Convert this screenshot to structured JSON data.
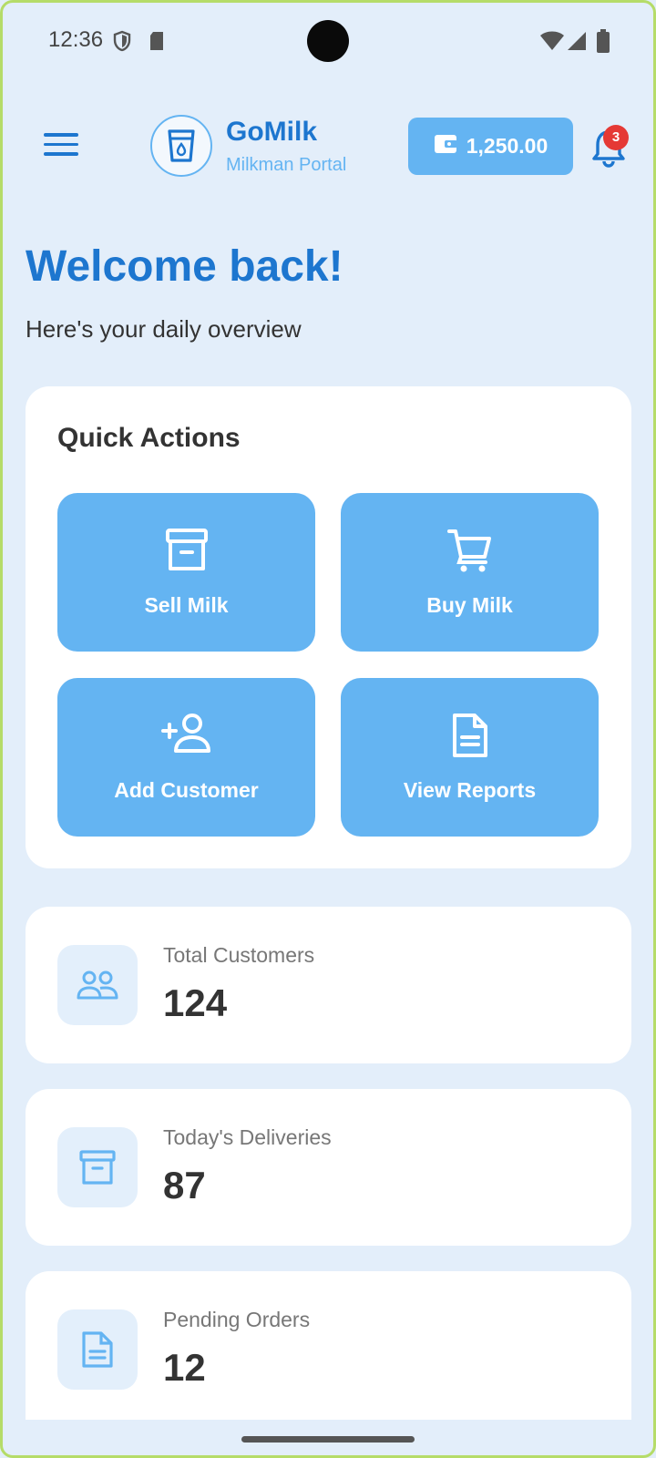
{
  "status_bar": {
    "time": "12:36"
  },
  "header": {
    "menu_icon": "hamburger-menu-icon",
    "logo_icon": "milk-glass-icon",
    "brand_name": "GoMilk",
    "brand_subtitle": "Milkman Portal",
    "wallet_icon": "wallet-icon",
    "wallet_balance": "1,250.00",
    "notification_icon": "bell-icon",
    "notification_count": "3"
  },
  "welcome": {
    "title": "Welcome back!",
    "subtitle": "Here's your daily overview"
  },
  "quick_actions": {
    "title": "Quick Actions",
    "items": [
      {
        "label": "Sell Milk",
        "icon": "archive-box-icon"
      },
      {
        "label": "Buy Milk",
        "icon": "shopping-cart-icon"
      },
      {
        "label": "Add Customer",
        "icon": "person-add-icon"
      },
      {
        "label": "View Reports",
        "icon": "document-icon"
      }
    ]
  },
  "stats": [
    {
      "label": "Total Customers",
      "value": "124",
      "icon": "people-icon"
    },
    {
      "label": "Today's Deliveries",
      "value": "87",
      "icon": "archive-box-icon"
    },
    {
      "label": "Pending Orders",
      "value": "12",
      "icon": "document-icon"
    }
  ],
  "colors": {
    "background": "#e3eefa",
    "primary": "#1d76cf",
    "accent": "#64b4f2",
    "badge": "#e53935",
    "card": "#ffffff"
  }
}
